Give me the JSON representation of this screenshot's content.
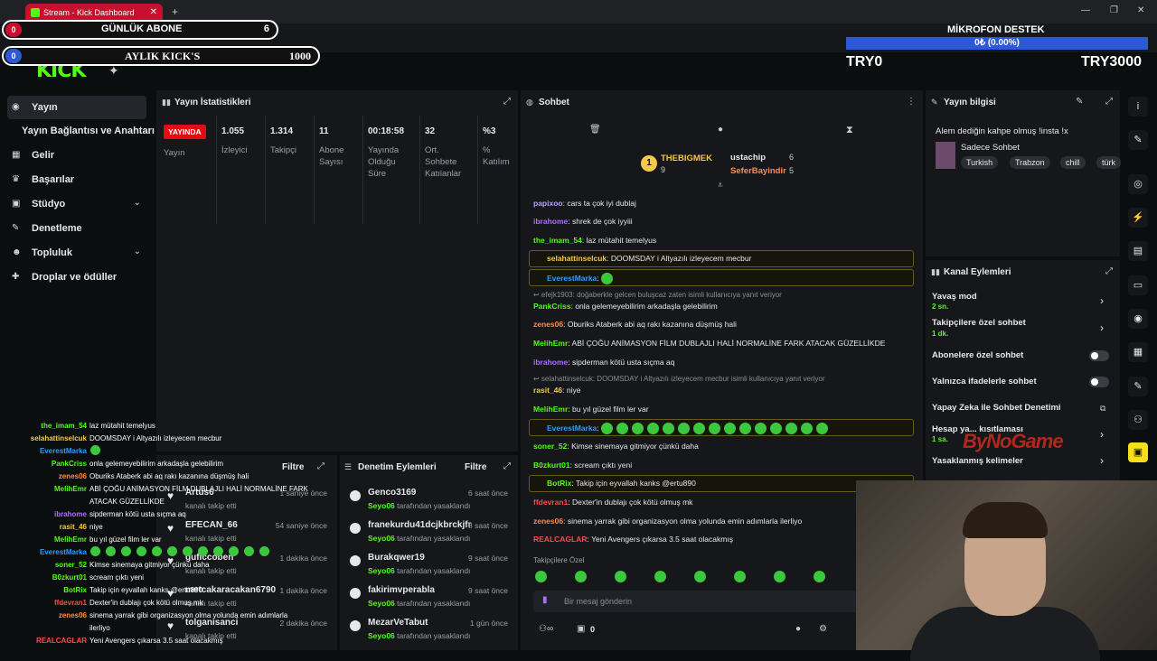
{
  "browser": {
    "tab_title": "Stream - Kick Dashboard",
    "url": "dashboard.kick.com/stream"
  },
  "overlays": {
    "daily_subs_badge": "0",
    "daily_subs_label": "GÜNLÜK ABONE",
    "daily_subs_value": "6",
    "monthly_kicks_badge": "0",
    "monthly_kicks_label": "AYLIK KICK'S",
    "monthly_kicks_value": "1000",
    "mic_title": "MİKROFON DESTEK",
    "mic_progress_text": "0₺ (0.00%)",
    "mic_progress_fraction": 0,
    "try_current": "TRY0",
    "try_goal": "TRY3000",
    "watermark": "ByNoGame"
  },
  "sidebar": {
    "logo": "KICK",
    "items": [
      {
        "label": "Yayın",
        "icon": "broadcast-icon"
      },
      {
        "label": "Yayın Bağlantısı ve Anahtarı",
        "icon": ""
      },
      {
        "label": "Gelir",
        "icon": "chart-icon"
      },
      {
        "label": "Başarılar",
        "icon": "trophy-icon"
      },
      {
        "label": "Stüdyo",
        "icon": "grid-icon"
      },
      {
        "label": "Denetleme",
        "icon": "wrench-icon"
      },
      {
        "label": "Topluluk",
        "icon": "people-icon"
      },
      {
        "label": "Droplar ve ödüller",
        "icon": "gift-icon"
      }
    ]
  },
  "stats": {
    "title": "Yayın İstatistikleri",
    "live_badge": "YAYINDA",
    "live_label": "Yayın",
    "columns": [
      {
        "value": "1.055",
        "label": "İzleyici"
      },
      {
        "value": "1.314",
        "label": "Takipçi"
      },
      {
        "value": "11",
        "label": "Abone Sayısı"
      },
      {
        "value": "00:18:58",
        "label": "Yayında Olduğu Süre"
      },
      {
        "value": "32",
        "label": "Ort. Sohbete Katılanlar"
      },
      {
        "value": "%3",
        "label": "% Katılım"
      }
    ]
  },
  "chat": {
    "title": "Sohbet",
    "top_gifters": [
      {
        "rank": "1",
        "name": "THEBIGMEK",
        "count": "9"
      },
      {
        "name": "ustachip",
        "count": "6"
      },
      {
        "name": "SeferBayindir",
        "count": "5"
      }
    ],
    "messages": [
      {
        "user": "papixoo",
        "color": "#b9a3ff",
        "text": "cars ta çok iyi dublaj"
      },
      {
        "user": "ibrahome",
        "color": "#a970ff",
        "text": "shrek de çok iyyiii"
      },
      {
        "user": "the_imam_54",
        "color": "#53fc18",
        "text": "laz mütahit temelyus"
      },
      {
        "user": "selahattinselcuk",
        "color": "#f7c948",
        "text": "DOOMSDAY i Altyazılı izleyecem mecbur",
        "highlight": true
      },
      {
        "user": "EverestMarka",
        "color": "#2f9bff",
        "text": "",
        "highlight": true
      },
      {
        "reply": "efejk1903: doğaberkle gelcen buluşcaz zaten isimli kullanıcıya yanıt veriyor"
      },
      {
        "user": "PankCriss",
        "color": "#53fc18",
        "text": "onla gelemeyebilirim arkadaşla gelebilirim"
      },
      {
        "user": "zenes06",
        "color": "#ff8c4a",
        "text": "Oburiks Ataberk abi aq rakı kazanına düşmüş hali"
      },
      {
        "user": "MelihEmr",
        "color": "#53fc18",
        "text": "ABİ ÇOĞU ANİMASYON FİLM DUBLAJLI HALİ NORMALİNE FARK ATACAK GÜZELLİKDE"
      },
      {
        "user": "ibrahome",
        "color": "#a970ff",
        "text": "sipderman kötü usta sıçma aq"
      },
      {
        "reply": "selahattinselcuk: DOOMSDAY i Altyazılı izleyecem mecbur isimli kullanıcıya yanıt veriyor"
      },
      {
        "user": "rasit_46",
        "color": "#f7c948",
        "text": "niye"
      },
      {
        "user": "MelihEmr",
        "color": "#53fc18",
        "text": "bu yıl güzel film ler var"
      },
      {
        "user": "EverestMarka",
        "color": "#2f9bff",
        "text": "",
        "highlight": true
      },
      {
        "user": "soner_52",
        "color": "#53fc18",
        "text": "Kimse sinemaya gitmiyor çünkü daha"
      },
      {
        "user": "B0zkurt01",
        "color": "#53fc18",
        "text": "scream çıktı yeni"
      },
      {
        "user": "BotRix",
        "color": "#53fc18",
        "text": "Takip için eyvallah kanks @ertu890",
        "highlight": true
      },
      {
        "user": "ffdevran1",
        "color": "#ff4a4a",
        "text": "Dexter'in dublajı çok kötü olmuş mk"
      },
      {
        "user": "zenes06",
        "color": "#ff8c4a",
        "text": "sinema yarrak gibi organizasyon olma yolunda emin adımlarla ilerliyo"
      },
      {
        "user": "REALCAGLAR",
        "color": "#ff4a4a",
        "text": "Yeni Avengers çıkarsa 3.5 saat olacakmış"
      }
    ],
    "followers_only_label": "Takipçilere Özel",
    "input_placeholder": "Bir mesaj gönderin",
    "viewer_count": "0"
  },
  "stream_info": {
    "title": "Yayın bilgisi",
    "stream_title": "Alem dediğin kahpe olmuş !insta !x",
    "category": "Sadece Sohbet",
    "tags": [
      "Turkish",
      "Trabzon",
      "chill",
      "türk"
    ]
  },
  "channel_actions": {
    "title": "Kanal Eylemleri",
    "rows": [
      {
        "label": "Yavaş mod",
        "sub": "2 sn."
      },
      {
        "label": "Takipçilere özel sohbet",
        "sub": "1 dk."
      },
      {
        "label": "Abonelere özel sohbet",
        "sub": ""
      },
      {
        "label": "Yalnızca ifadelerle sohbet",
        "sub": ""
      },
      {
        "label": "Yapay Zeka ile Sohbet Denetimi",
        "sub": ""
      },
      {
        "label": "Hesap ya... kısıtlaması",
        "sub": "1 sa."
      },
      {
        "label": "Yasaklanmış kelimeler",
        "sub": ""
      }
    ]
  },
  "activity": {
    "filter_label": "Filtre",
    "followers": [
      {
        "name": "Artus6",
        "sub": "kanalı takip etti",
        "time": "1 saniye önce"
      },
      {
        "name": "EFECAN_66",
        "sub": "kanalı takip etti",
        "time": "54 saniye önce"
      },
      {
        "name": "guficcoben",
        "sub": "kanalı takip etti",
        "time": "1 dakika önce"
      },
      {
        "name": "metcakaracakan6790",
        "sub": "kanalı takip etti",
        "time": "1 dakika önce"
      },
      {
        "name": "tolganisanci",
        "sub": "kanalı takip etti",
        "time": "2 dakika önce"
      }
    ]
  },
  "moderation": {
    "title": "Denetim Eylemleri",
    "filter_label": "Filtre",
    "items": [
      {
        "name": "Genco3169",
        "by": "Seyo06",
        "action": "tarafından yasaklandı",
        "time": "6 saat önce"
      },
      {
        "name": "franekurdu41dcjkbrckjfr",
        "by": "Seyo06",
        "action": "tarafından yasaklandı",
        "time": "8 saat önce"
      },
      {
        "name": "Burakqwer19",
        "by": "Seyo06",
        "action": "tarafından yasaklandı",
        "time": "9 saat önce"
      },
      {
        "name": "fakirimvperabla",
        "by": "Seyo06",
        "action": "tarafından yasaklandı",
        "time": "9 saat önce"
      },
      {
        "name": "MezarVeTabut",
        "by": "Seyo06",
        "action": "tarafından yasaklandı",
        "time": "1 gün önce"
      }
    ]
  },
  "overlay_chat": [
    {
      "user": "the_imam_54",
      "color": "#53fc18",
      "text": "laz mütahit temelyus"
    },
    {
      "user": "selahattinselcuk",
      "color": "#f7c948",
      "text": "DOOMSDAY i Altyazılı izleyecem mecbur"
    },
    {
      "user": "EverestMarka",
      "color": "#2f9bff",
      "text": ""
    },
    {
      "user": "PankCriss",
      "color": "#53fc18",
      "text": "onla gelemeyebilirim arkadaşla gelebilirim"
    },
    {
      "user": "zenes06",
      "color": "#ff8c4a",
      "text": "Oburiks Ataberk abi aq rakı kazanına düşmüş hali"
    },
    {
      "user": "MelihEmr",
      "color": "#53fc18",
      "text": "ABİ ÇOĞU ANİMASYON FİLM DUBLAJLI HALİ NORMALİNE FARK"
    },
    {
      "user": "",
      "color": "#53fc18",
      "text": "ATACAK GÜZELLİKDE"
    },
    {
      "user": "ibrahome",
      "color": "#a970ff",
      "text": "sipderman kötü usta sıçma aq"
    },
    {
      "user": "rasit_46",
      "color": "#f7c948",
      "text": "niye"
    },
    {
      "user": "MelihEmr",
      "color": "#53fc18",
      "text": "bu yıl güzel film ler var"
    },
    {
      "user": "EverestMarka",
      "color": "#2f9bff",
      "text": ""
    },
    {
      "user": "soner_52",
      "color": "#53fc18",
      "text": "Kimse sinemaya gitmiyor çünkü daha"
    },
    {
      "user": "B0zkurt01",
      "color": "#53fc18",
      "text": "scream çıktı yeni"
    },
    {
      "user": "BotRix",
      "color": "#53fc18",
      "text": "Takip için eyvallah kanks @ertu890"
    },
    {
      "user": "ffdevran1",
      "color": "#ff4a4a",
      "text": "Dexter'in dublajı çok kötü olmuş mk"
    },
    {
      "user": "zenes06",
      "color": "#ff8c4a",
      "text": "sinema yarrak gibi organizasyon olma yolunda emin adımlarla"
    },
    {
      "user": "",
      "color": "#ff8c4a",
      "text": "ilerliyo"
    },
    {
      "user": "REALCAGLAR",
      "color": "#ff4a4a",
      "text": "Yeni Avengers çıkarsa 3.5 saat olacakmış"
    }
  ]
}
